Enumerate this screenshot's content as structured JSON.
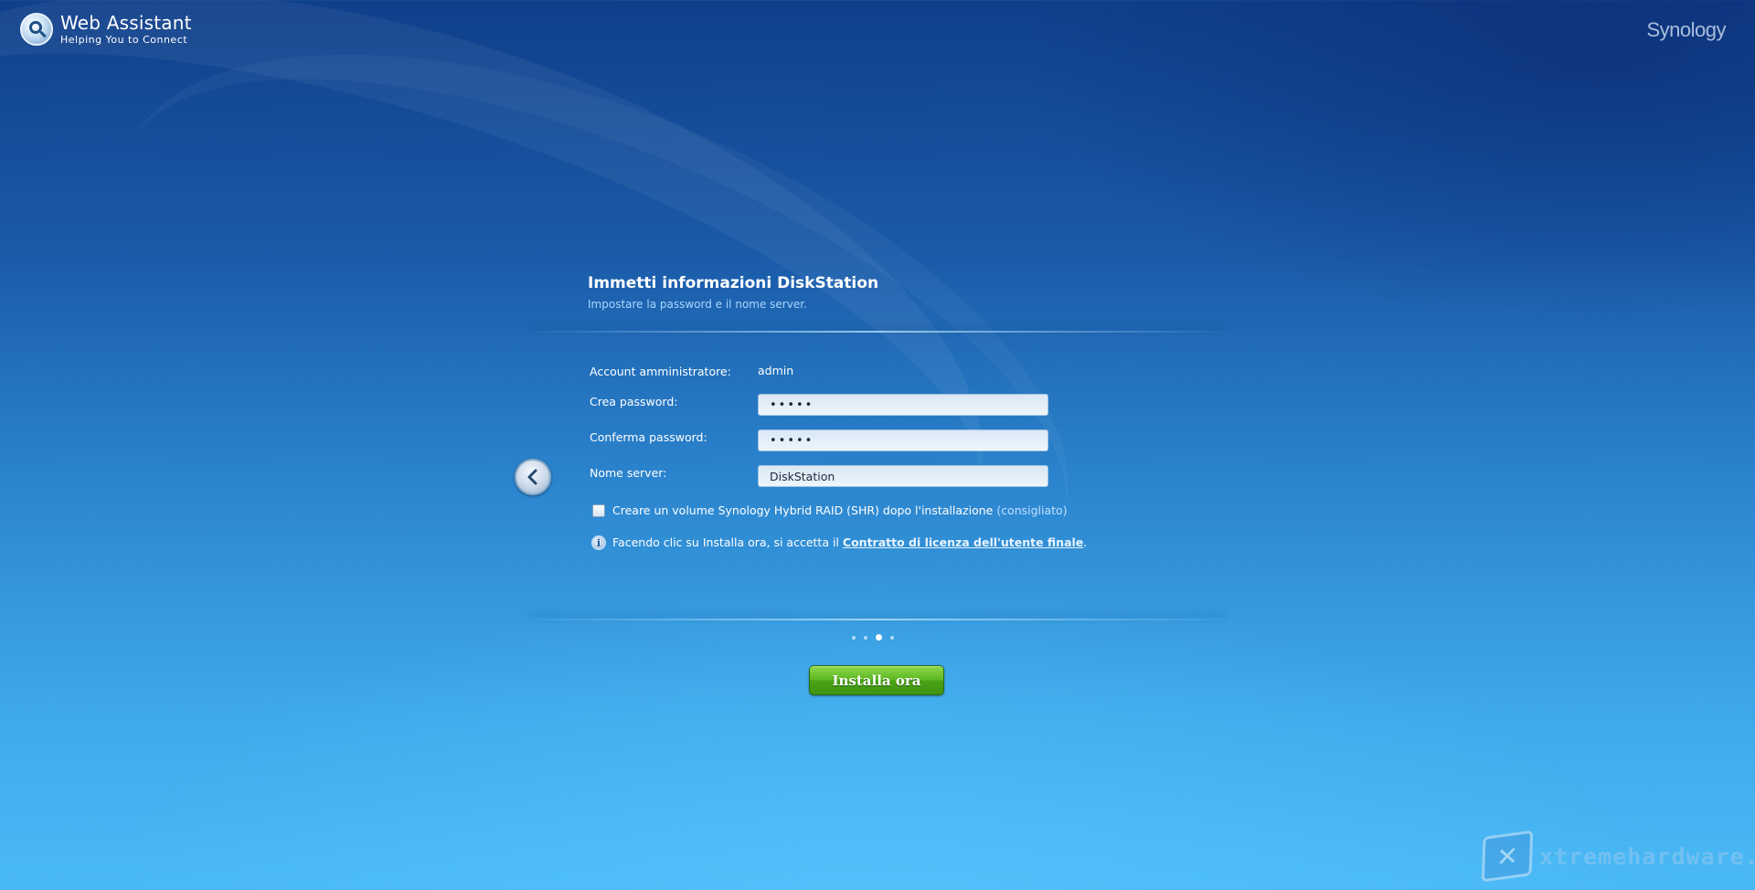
{
  "header": {
    "app_title": "Web Assistant",
    "app_subtitle": "Helping You to Connect",
    "brand": "Synology"
  },
  "panel": {
    "title": "Immetti informazioni DiskStation",
    "subtitle": "Impostare la password e il nome server."
  },
  "form": {
    "admin_label": "Account amministratore:",
    "admin_value": "admin",
    "password_label": "Crea password:",
    "password_value": "•••••",
    "confirm_label": "Conferma password:",
    "confirm_value": "•••••",
    "server_label": "Nome server:",
    "server_value": "DiskStation"
  },
  "shr_option": {
    "label": "Creare un volume Synology Hybrid RAID (SHR) dopo l'installazione",
    "note": "(consigliato)",
    "checked": false
  },
  "license": {
    "text": "Facendo clic su Installa ora, si accetta il",
    "link": "Contratto di licenza dell'utente finale",
    "suffix": "."
  },
  "steps": {
    "total": 4,
    "current": 3
  },
  "install_button": "Installa ora",
  "icons": {
    "app_logo": "web-assistant-logo-icon",
    "back": "chevron-left-icon",
    "info": "info-icon"
  },
  "watermark": "xtremehardware.com",
  "colors": {
    "install_button": "#5cb821",
    "link": "#e8f4ff",
    "background_top": "#103f8a",
    "background_bottom": "#4abaf6"
  }
}
